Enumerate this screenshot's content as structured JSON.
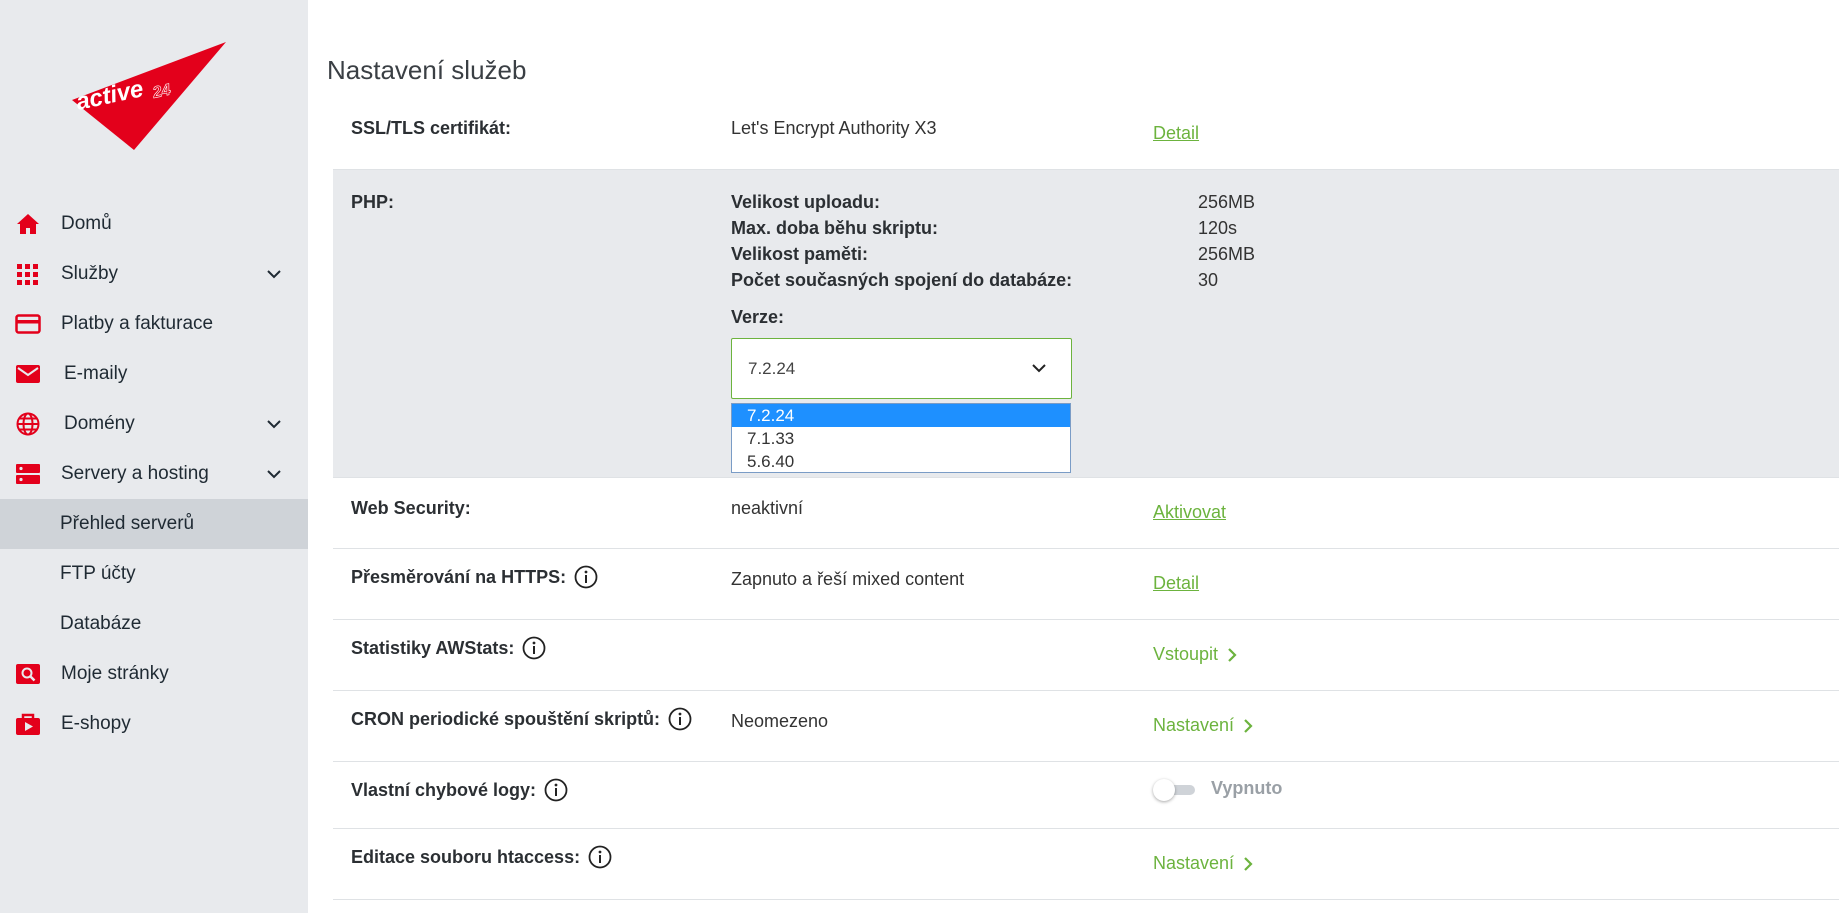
{
  "brand": {
    "logo_text": "active 24",
    "primary_color": "#e3001b",
    "accent_color": "#6cb33e"
  },
  "sidebar": {
    "items": [
      {
        "label": "Domů",
        "icon": "home-icon"
      },
      {
        "label": "Služby",
        "icon": "grid-icon",
        "expandable": true
      },
      {
        "label": "Platby a fakturace",
        "icon": "credit-card-icon"
      },
      {
        "label": "E-maily",
        "icon": "envelope-icon"
      },
      {
        "label": "Domény",
        "icon": "globe-icon",
        "expandable": true
      },
      {
        "label": "Servery a hosting",
        "icon": "server-icon",
        "expandable": true,
        "expanded": true
      },
      {
        "label": "Přehled serverů",
        "sub": true,
        "active": true
      },
      {
        "label": "FTP účty",
        "sub": true
      },
      {
        "label": "Databáze",
        "sub": true
      },
      {
        "label": "Moje stránky",
        "icon": "web-search-icon"
      },
      {
        "label": "E-shopy",
        "icon": "shop-bag-icon"
      }
    ]
  },
  "main": {
    "title": "Nastavení služeb",
    "ssl": {
      "label": "SSL/TLS certifikát:",
      "value": "Let's Encrypt Authority X3",
      "action": "Detail"
    },
    "php": {
      "label": "PHP:",
      "settings": [
        {
          "key": "Velikost uploadu:",
          "value": "256MB"
        },
        {
          "key": "Max. doba běhu skriptu:",
          "value": "120s"
        },
        {
          "key": "Velikost paměti:",
          "value": "256MB"
        },
        {
          "key": "Počet současných spojení do databáze:",
          "value": "30"
        }
      ],
      "version_label": "Verze:",
      "version_selected": "7.2.24",
      "version_options": [
        "7.2.24",
        "7.1.33",
        "5.6.40"
      ]
    },
    "web_security": {
      "label": "Web Security:",
      "value": "neaktivní",
      "action": "Aktivovat"
    },
    "https_redirect": {
      "label": "Přesměrování na HTTPS:",
      "value": "Zapnuto a řeší mixed content",
      "action": "Detail"
    },
    "awstats": {
      "label": "Statistiky AWStats:",
      "action": "Vstoupit"
    },
    "cron": {
      "label": "CRON periodické spouštění skriptů:",
      "value": "Neomezeno",
      "action": "Nastavení"
    },
    "error_logs": {
      "label": "Vlastní chybové logy:",
      "toggle_state": "Vypnuto",
      "toggle_on": false
    },
    "htaccess": {
      "label": "Editace souboru htaccess:",
      "action": "Nastavení"
    }
  }
}
